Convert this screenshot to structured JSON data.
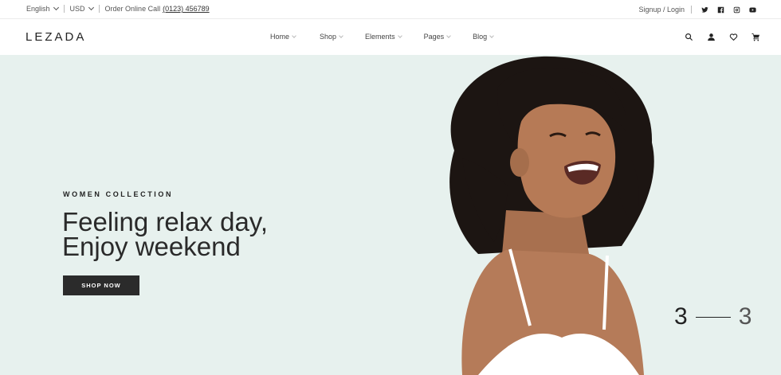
{
  "topbar": {
    "language": "English",
    "currency": "USD",
    "order_label": "Order Online Call",
    "phone": "(0123) 456789",
    "auth": "Signup / Login",
    "social": [
      "twitter-icon",
      "facebook-icon",
      "instagram-icon",
      "youtube-icon"
    ]
  },
  "header": {
    "logo": "LEZADA",
    "nav": [
      "Home",
      "Shop",
      "Elements",
      "Pages",
      "Blog"
    ],
    "icons": [
      "search-icon",
      "user-icon",
      "heart-icon",
      "cart-icon"
    ]
  },
  "hero": {
    "eyebrow": "WOMEN COLLECTION",
    "headline_line1": "Feeling relax day,",
    "headline_line2": "Enjoy weekend",
    "cta": "SHOP NOW",
    "slide_current": "3",
    "slide_total": "3",
    "background": "#e7f1ee"
  }
}
